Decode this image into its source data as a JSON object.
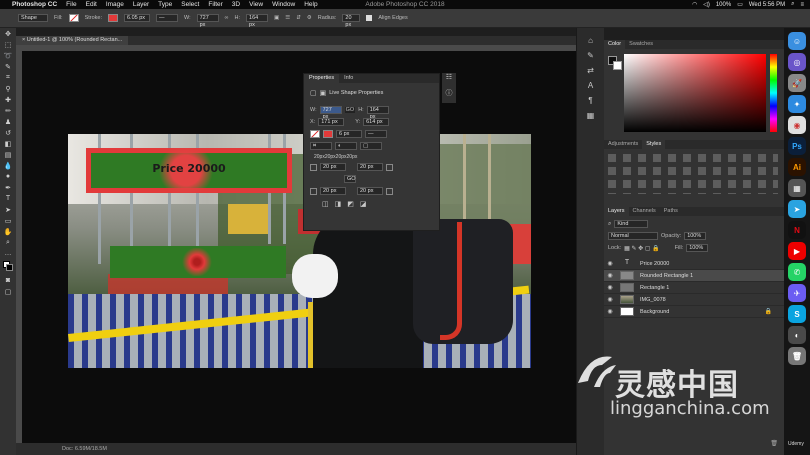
{
  "menubar": {
    "app": "Photoshop CC",
    "items": [
      "File",
      "Edit",
      "Image",
      "Layer",
      "Type",
      "Select",
      "Filter",
      "3D",
      "View",
      "Window",
      "Help"
    ],
    "battery": "100%",
    "clock": "Wed 5:56 PM"
  },
  "window_title": "Adobe Photoshop CC 2018",
  "options_bar": {
    "mode": "Shape",
    "fill_label": "Fill:",
    "stroke_label": "Stroke:",
    "stroke_width": "6.05 px",
    "w_label": "W:",
    "w_value": "727 px",
    "h_label": "H:",
    "h_value": "164 px",
    "radius_label": "Radius:",
    "radius_value": "20 px",
    "align_edges": "Align Edges"
  },
  "document": {
    "tab": "Untitled-1 @ 100% (Rounded Rectan...",
    "status": "Doc: 6.59M/18.5M"
  },
  "canvas_text": {
    "price": "Price 20000"
  },
  "properties": {
    "tabs": [
      "Properties",
      "Info"
    ],
    "section": "Live Shape Properties",
    "w_label": "W:",
    "w": "727 px",
    "go": "GO",
    "h_label": "H:",
    "h": "164 px",
    "x_label": "X:",
    "x": "171 px",
    "y_label": "Y:",
    "y": "614 px",
    "stroke_size": "6 px",
    "corners": "20px20px20px20px",
    "r1": "20 px",
    "r2": "20 px",
    "r3": "20 px",
    "r4": "20 px",
    "link": "GO"
  },
  "color_panel": {
    "tabs": [
      "Color",
      "Swatches"
    ]
  },
  "adjust_panel": {
    "tabs": [
      "Adjustments",
      "Styles"
    ]
  },
  "layers_panel": {
    "tabs": [
      "Layers",
      "Channels",
      "Paths"
    ],
    "kind": "Kind",
    "blend": "Normal",
    "opacity_label": "Opacity:",
    "opacity": "100%",
    "lock_label": "Lock:",
    "fill_label": "Fill:",
    "fill": "100%",
    "layers": [
      "Price 20000",
      "Rounded Rectangle 1",
      "Rectangle 1",
      "IMG_0078",
      "Background"
    ]
  },
  "watermark": {
    "chinese": "灵感中国",
    "url": "lingganchina.com",
    "udemy": "Udemy"
  },
  "colors": {
    "accent_red": "#e23a3a",
    "shape_green": "#2f7a24",
    "rail_yellow": "#f0cf10"
  }
}
